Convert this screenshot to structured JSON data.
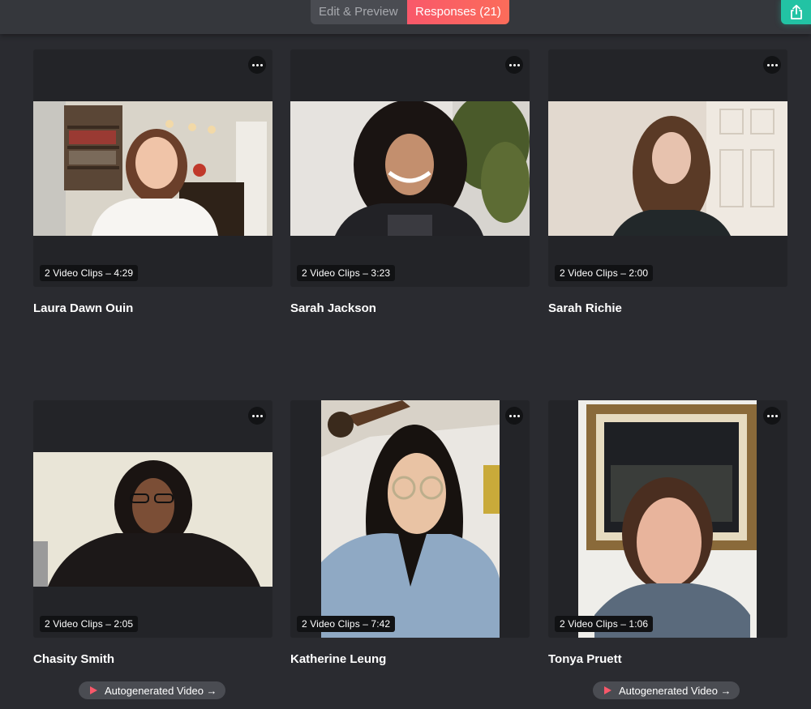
{
  "header": {
    "tabs": [
      {
        "label": "Edit & Preview",
        "active": false
      },
      {
        "label": "Responses (21)",
        "active": true
      }
    ],
    "share_icon": "share-upload-icon",
    "accent": "#22c3a4",
    "responses_gradient": [
      "#f9586a",
      "#fb6c5a"
    ]
  },
  "responses": [
    {
      "name": "Laura Dawn Ouin",
      "clips": "2 Video Clips – 4:29",
      "autogenerated": null
    },
    {
      "name": "Sarah Jackson",
      "clips": "2 Video Clips – 3:23",
      "autogenerated": null
    },
    {
      "name": "Sarah Richie",
      "clips": "2 Video Clips – 2:00",
      "autogenerated": null
    },
    {
      "name": "Chasity Smith",
      "clips": "2 Video Clips – 2:05",
      "autogenerated": "Autogenerated Video →"
    },
    {
      "name": "Katherine Leung",
      "clips": "2 Video Clips – 7:42",
      "autogenerated": null
    },
    {
      "name": "Tonya Pruett",
      "clips": "2 Video Clips – 1:06",
      "autogenerated": "Autogenerated Video →"
    }
  ]
}
